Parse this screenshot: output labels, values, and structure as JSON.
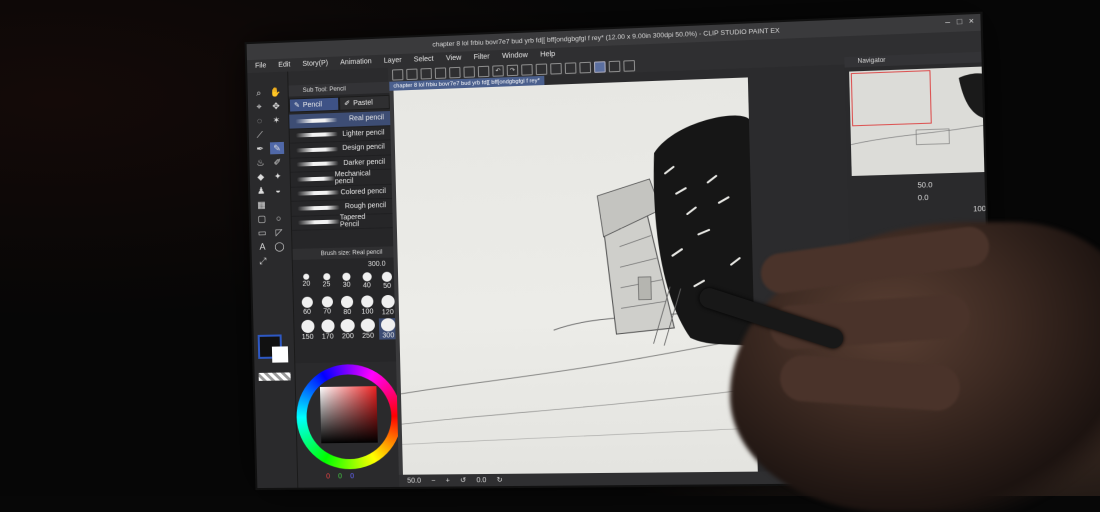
{
  "window": {
    "title": "chapter 8 lol frbiu bovr7e7 bud yrb  fd[[ bff[ondgbgfgl f rey* (12.00 x 9.00in 300dpi 50.0%) - CLIP STUDIO PAINT EX",
    "controls": [
      "–",
      "□",
      "×"
    ]
  },
  "menu": [
    "File",
    "Edit",
    "Story(P)",
    "Animation",
    "Layer",
    "Select",
    "View",
    "Filter",
    "Window",
    "Help"
  ],
  "subtool": {
    "header": "Sub Tool: Pencil",
    "tabs": [
      {
        "label": "Pencil",
        "active": true
      },
      {
        "label": "Pastel",
        "active": false
      }
    ],
    "brushes": [
      {
        "label": "Real pencil",
        "active": true
      },
      {
        "label": "Lighter pencil",
        "active": false
      },
      {
        "label": "Design pencil",
        "active": false
      },
      {
        "label": "Darker pencil",
        "active": false
      },
      {
        "label": "Mechanical pencil",
        "active": false
      },
      {
        "label": "Colored pencil",
        "active": false
      },
      {
        "label": "Rough pencil",
        "active": false
      },
      {
        "label": "Tapered Pencil",
        "active": false
      }
    ],
    "brush_size_title": "Brush size: Real pencil",
    "brush_size_value": "300.0",
    "sizes": [
      "20",
      "25",
      "30",
      "40",
      "50",
      "60",
      "70",
      "80",
      "100",
      "120",
      "150",
      "170",
      "200",
      "250",
      "300"
    ]
  },
  "canvas": {
    "tab": "chapter 8 lol frbiu bovr7e7 bud yrb  fd[[ bff[ondgbgfgl f rey*",
    "zoom": "50.0",
    "rotation": "0.0"
  },
  "navigator": {
    "title": "Navigator",
    "zoom": "50.0",
    "rotation": "0.0",
    "opacity": "100"
  },
  "color": {
    "r": "0",
    "g": "0",
    "b": "0",
    "main_color": "#111111",
    "sub_color": "#ffffff"
  }
}
